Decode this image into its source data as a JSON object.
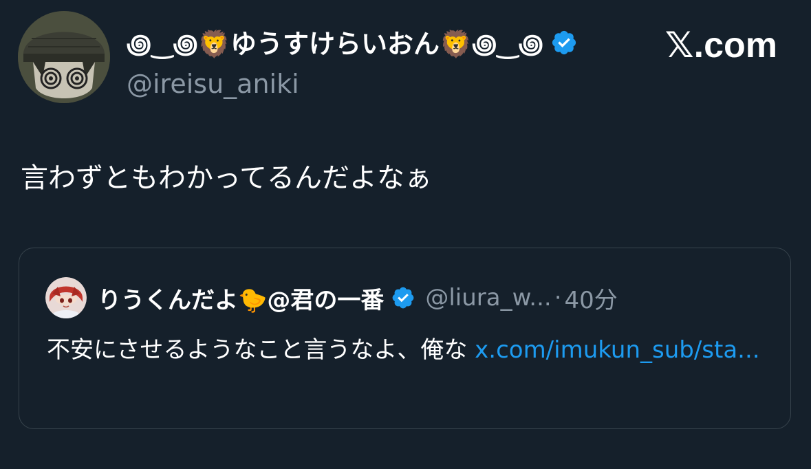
{
  "author": {
    "display_name": "꩜‿꩜🦁ゆうすけらいおん🦁꩜‿꩜",
    "handle": "@ireisu_aniki",
    "verified": true
  },
  "brand": {
    "label": "𝕏.com"
  },
  "tweet": {
    "text": "言わずともわかってるんだよなぁ"
  },
  "quoted_tweet": {
    "display_name": "りうくんだよ🐤@君の一番",
    "handle": "@liura_w...",
    "separator": "·",
    "time": "40分",
    "verified": true,
    "text": "不安にさせるようなこと言うなよ、俺な ",
    "link": "x.com/imukun_sub/sta..."
  },
  "colors": {
    "background": "#15202b",
    "secondary_text": "#8b98a5",
    "link": "#1d9bf0",
    "verified_badge": "#1d9bf0",
    "card_border": "#38444d"
  },
  "icons": {
    "author_avatar": "avatar-beanie-swirl-eyes",
    "quoted_avatar": "avatar-red-hair-anime",
    "verified": "verified-badge-icon"
  }
}
